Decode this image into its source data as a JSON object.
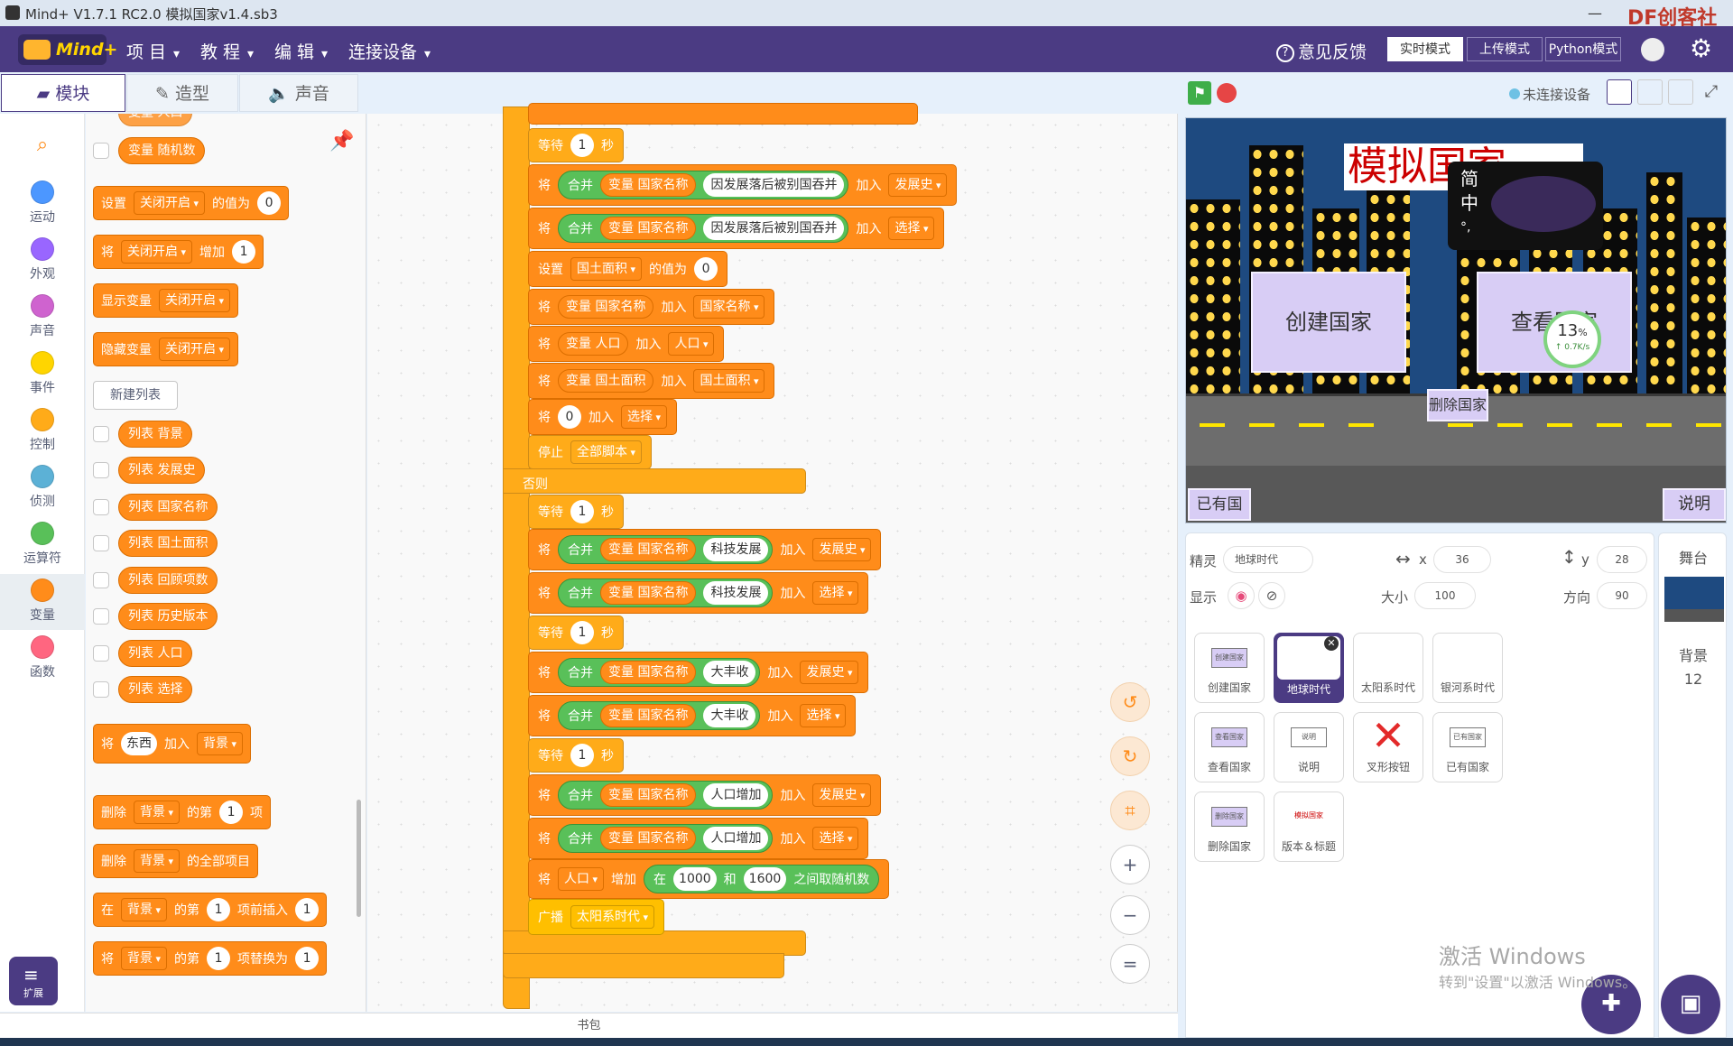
{
  "window": {
    "title": "Mind+ V1.7.1 RC2.0   模拟国家v1.4.sb3",
    "controls": [
      "—",
      "☐",
      "✕"
    ],
    "watermark": "DF创客社区"
  },
  "menubar": {
    "logo": "Mind+",
    "items": [
      "项 目",
      "教 程",
      "编 辑",
      "连接设备"
    ],
    "feedback": "意见反馈",
    "modes": [
      "实时模式",
      "上传模式",
      "Python模式"
    ]
  },
  "tabs": [
    "模块",
    "造型",
    "声音"
  ],
  "categories": [
    {
      "label": "",
      "color": "#ffffff"
    },
    {
      "label": "运动",
      "color": "#4c97ff"
    },
    {
      "label": "外观",
      "color": "#9966ff"
    },
    {
      "label": "声音",
      "color": "#cf63cf"
    },
    {
      "label": "事件",
      "color": "#ffd500"
    },
    {
      "label": "控制",
      "color": "#ffab19"
    },
    {
      "label": "侦测",
      "color": "#5cb1d6"
    },
    {
      "label": "运算符",
      "color": "#59c059"
    },
    {
      "label": "变量",
      "color": "#ff8c1a"
    },
    {
      "label": "函数",
      "color": "#ff6680"
    }
  ],
  "palette": {
    "var_random": "变量 随机数",
    "set_block": {
      "a": "设置",
      "var": "关闭开启",
      "b": "的值为",
      "val": "0"
    },
    "change_block": {
      "a": "将",
      "var": "关闭开启",
      "b": "增加",
      "val": "1"
    },
    "show_var": {
      "a": "显示变量",
      "var": "关闭开启"
    },
    "hide_var": {
      "a": "隐藏变量",
      "var": "关闭开启"
    },
    "new_list": "新建列表",
    "lists": [
      "列表 背景",
      "列表 发展史",
      "列表 国家名称",
      "列表 国土面积",
      "列表 回顾项数",
      "列表 历史版本",
      "列表 人口",
      "列表 选择"
    ],
    "add_block": {
      "a": "将",
      "item": "东西",
      "b": "加入",
      "list": "背景"
    },
    "delete_block": {
      "a": "删除",
      "list": "背景",
      "b": "的第",
      "n": "1",
      "c": "项"
    },
    "delete_all": {
      "a": "删除",
      "list": "背景",
      "b": "的全部项目"
    },
    "insert_block": {
      "a": "在",
      "list": "背景",
      "b": "的第",
      "n": "1",
      "c": "项前插入",
      "v": "1"
    },
    "replace_block": {
      "a": "将",
      "list": "背景",
      "b": "的第",
      "n": "1",
      "c": "项替换为",
      "v": "1"
    },
    "extend": "扩展"
  },
  "script": {
    "wait1": {
      "a": "等待",
      "n": "1",
      "b": "秒"
    },
    "join1": {
      "a": "将",
      "join": "合并",
      "var": "变量 国家名称",
      "text": "因发展落后被别国吞并",
      "add": "加入",
      "list": "发展史"
    },
    "join2": {
      "a": "将",
      "join": "合并",
      "var": "变量 国家名称",
      "text": "因发展落后被别国吞并",
      "add": "加入",
      "list": "选择"
    },
    "set_area": {
      "a": "设置",
      "var": "国土面积",
      "b": "的值为",
      "v": "0"
    },
    "add_name": {
      "a": "将",
      "var": "变量 国家名称",
      "add": "加入",
      "list": "国家名称"
    },
    "add_pop": {
      "a": "将",
      "var": "变量 人口",
      "add": "加入",
      "list": "人口"
    },
    "add_area": {
      "a": "将",
      "var": "变量 国土面积",
      "add": "加入",
      "list": "国土面积"
    },
    "add_zero": {
      "a": "将",
      "v": "0",
      "add": "加入",
      "list": "选择"
    },
    "stop": {
      "a": "停止",
      "opt": "全部脚本"
    },
    "else_label": "否则",
    "wait2": {
      "a": "等待",
      "n": "1",
      "b": "秒"
    },
    "tech1": {
      "a": "将",
      "join": "合并",
      "var": "变量 国家名称",
      "text": "科技发展",
      "add": "加入",
      "list": "发展史"
    },
    "tech2": {
      "a": "将",
      "join": "合并",
      "var": "变量 国家名称",
      "text": "科技发展",
      "add": "加入",
      "list": "选择"
    },
    "wait3": {
      "a": "等待",
      "n": "1",
      "b": "秒"
    },
    "harvest1": {
      "a": "将",
      "join": "合并",
      "var": "变量 国家名称",
      "text": "大丰收",
      "add": "加入",
      "list": "发展史"
    },
    "harvest2": {
      "a": "将",
      "join": "合并",
      "var": "变量 国家名称",
      "text": "大丰收",
      "add": "加入",
      "list": "选择"
    },
    "wait4": {
      "a": "等待",
      "n": "1",
      "b": "秒"
    },
    "pop1": {
      "a": "将",
      "join": "合并",
      "var": "变量 国家名称",
      "text": "人口增加",
      "add": "加入",
      "list": "发展史"
    },
    "pop2": {
      "a": "将",
      "join": "合并",
      "var": "变量 国家名称",
      "text": "人口增加",
      "add": "加入",
      "list": "选择"
    },
    "incr_pop": {
      "a": "将",
      "var": "人口",
      "b": "增加",
      "c": "在",
      "min": "1000",
      "d": "和",
      "max": "1600",
      "e": "之间取随机数"
    },
    "broadcast": {
      "a": "广播",
      "msg": "太阳系时代"
    }
  },
  "workspace_tools": {
    "undo": "↺",
    "redo": "↻",
    "crop": "⌗",
    "zoom_in": "+",
    "zoom_out": "−",
    "reset": "="
  },
  "bag_label": "书包",
  "stage_header": {
    "device": "未连接设备"
  },
  "stage": {
    "title": "模拟国家",
    "popup_chars": [
      "简",
      "中",
      "°,"
    ],
    "create_btn": "创建国家",
    "view_btn": "查看国家",
    "delete_btn": "删除国家",
    "existing_btn": "已有国家",
    "help_btn": "说明",
    "progress": {
      "pct": "13",
      "unit": "%",
      "speed": "↑ 0.7K/s"
    }
  },
  "sprite_info": {
    "sprite_label": "精灵",
    "sprite_name": "地球时代",
    "x_label": "x",
    "x_val": "36",
    "y_label": "y",
    "y_val": "28",
    "show_label": "显示",
    "size_label": "大小",
    "size_val": "100",
    "dir_label": "方向",
    "dir_val": "90"
  },
  "sprites": [
    {
      "name": "创建国家",
      "thumb": "创建国家"
    },
    {
      "name": "地球时代",
      "thumb": ""
    },
    {
      "name": "太阳系时代",
      "thumb": ""
    },
    {
      "name": "银河系时代",
      "thumb": ""
    },
    {
      "name": "查看国家",
      "thumb": "查看国家"
    },
    {
      "name": "说明",
      "thumb": "说明"
    },
    {
      "name": "叉形按钮",
      "thumb": ""
    },
    {
      "name": "已有国家",
      "thumb": "已有国家"
    },
    {
      "name": "删除国家",
      "thumb": "删除国家"
    },
    {
      "name": "版本＆标题",
      "thumb": "模拟国家"
    }
  ],
  "stage_panel": {
    "label": "舞台",
    "bg_label": "背景",
    "bg_count": "12"
  },
  "activate": {
    "line1": "激活 Windows",
    "line2": "转到\"设置\"以激活 Windows。"
  }
}
